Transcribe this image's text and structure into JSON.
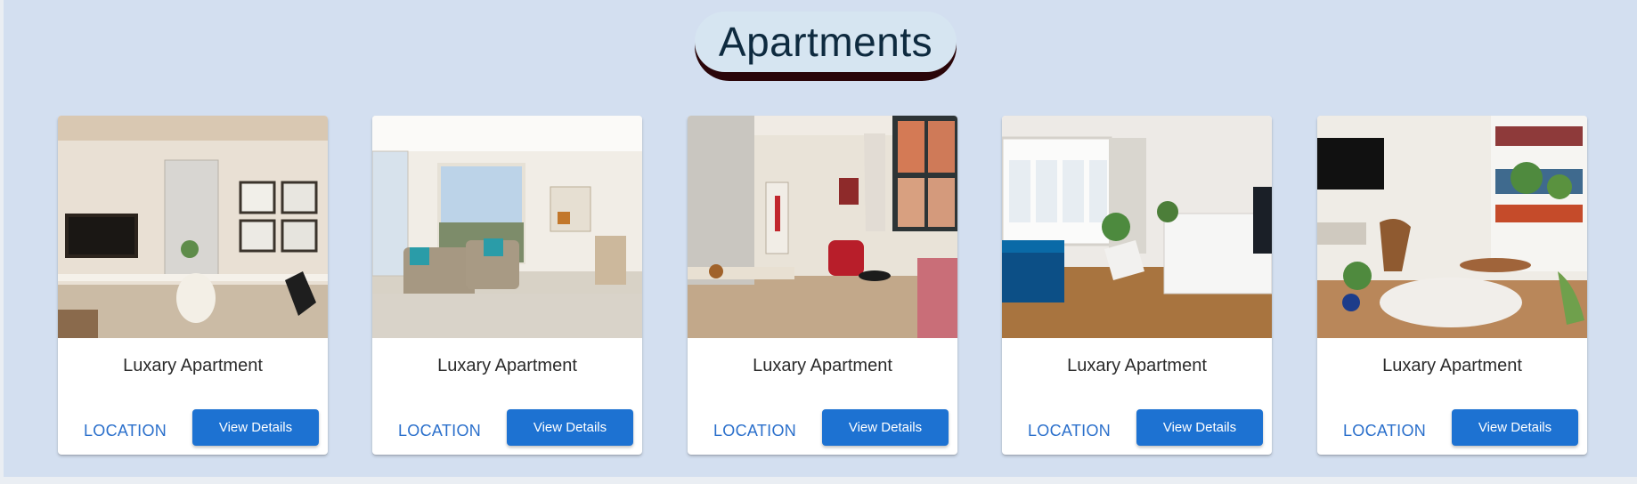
{
  "page": {
    "title": "Apartments"
  },
  "colors": {
    "accent": "#1d72d2",
    "link": "#2a6fcb",
    "background": "#d3dff0",
    "pill_shadow": "#2a0509"
  },
  "listings": [
    {
      "name": "Luxary Apartment",
      "location_label": "LOCATION",
      "button_label": "View Details",
      "image": "modern-living-room-photo"
    },
    {
      "name": "Luxary Apartment",
      "location_label": "LOCATION",
      "button_label": "View Details",
      "image": "open-plan-living-room-photo"
    },
    {
      "name": "Luxary Apartment",
      "location_label": "LOCATION",
      "button_label": "View Details",
      "image": "dining-living-room-photo"
    },
    {
      "name": "Luxary Apartment",
      "location_label": "LOCATION",
      "button_label": "View Details",
      "image": "scandinavian-living-room-photo"
    },
    {
      "name": "Luxary Apartment",
      "location_label": "LOCATION",
      "button_label": "View Details",
      "image": "plant-filled-living-room-photo"
    }
  ]
}
